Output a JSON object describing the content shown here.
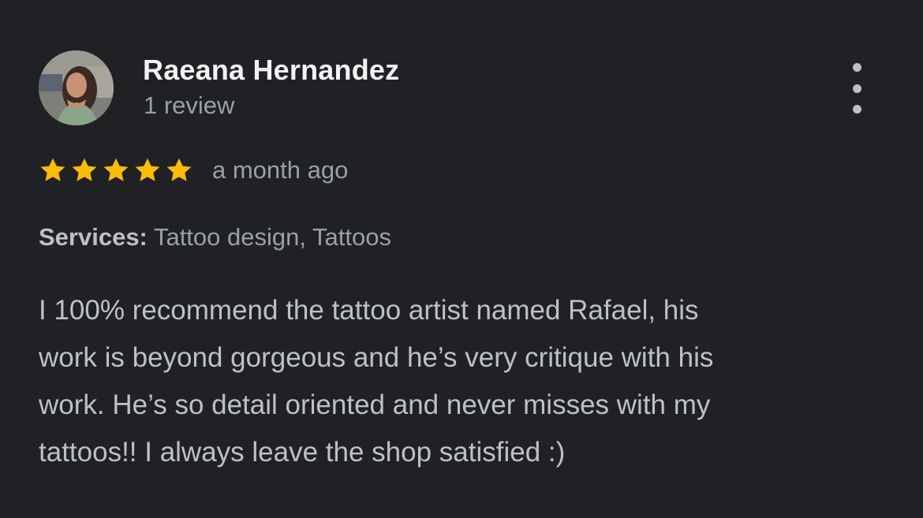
{
  "reviewer": {
    "name": "Raeana Hernandez",
    "review_count": "1 review",
    "avatar_icon": "reviewer-photo"
  },
  "more_menu_icon": "more-vertical-icon",
  "rating": {
    "stars": 5,
    "max_stars": 5,
    "time_ago": "a month ago",
    "star_color": "#fbbc04"
  },
  "services": {
    "label": "Services:",
    "value": "Tattoo design, Tattoos"
  },
  "review": {
    "lines": [
      "I 100% recommend the tattoo artist named Rafael, his",
      "work is beyond gorgeous and he’s very critique with his",
      "work. He’s so detail oriented and never misses with my",
      "tattoos!! I always leave the shop satisfied :)"
    ]
  },
  "colors": {
    "background": "#202124",
    "name": "#f1f3f4",
    "secondary_text": "#9aa0a6",
    "body_text": "#bdc1c6"
  }
}
